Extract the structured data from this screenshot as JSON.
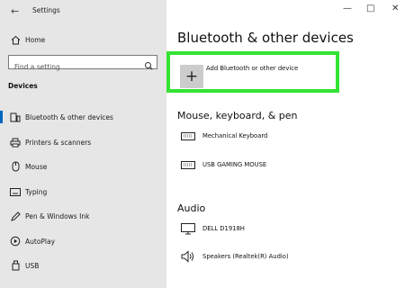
{
  "window": {
    "title": "Settings",
    "controls": [
      "—",
      "□",
      "✕"
    ]
  },
  "sidebar": {
    "home_label": "Home",
    "search_placeholder": "Find a setting",
    "section_label": "Devices",
    "items": [
      {
        "label": "Bluetooth & other devices",
        "icon": "bluetooth-devices-icon",
        "selected": true
      },
      {
        "label": "Printers & scanners",
        "icon": "printer-icon",
        "selected": false
      },
      {
        "label": "Mouse",
        "icon": "mouse-icon",
        "selected": false
      },
      {
        "label": "Typing",
        "icon": "keyboard-icon",
        "selected": false
      },
      {
        "label": "Pen & Windows Ink",
        "icon": "pen-icon",
        "selected": false
      },
      {
        "label": "AutoPlay",
        "icon": "autoplay-icon",
        "selected": false
      },
      {
        "label": "USB",
        "icon": "usb-icon",
        "selected": false
      }
    ]
  },
  "main": {
    "title": "Bluetooth & other devices",
    "add_device_label": "Add Bluetooth or other device",
    "groups": [
      {
        "heading": "Mouse, keyboard, & pen",
        "devices": [
          {
            "name": "Mechanical Keyboard",
            "icon": "keyboard-icon"
          },
          {
            "name": "USB GAMING MOUSE",
            "icon": "keyboard-icon"
          }
        ]
      },
      {
        "heading": "Audio",
        "devices": [
          {
            "name": "DELL D1918H",
            "icon": "monitor-icon"
          },
          {
            "name": "Speakers (Realtek(R) Audio)",
            "icon": "speaker-icon"
          }
        ]
      }
    ]
  },
  "colors": {
    "sidebar_bg": "#e6e6e6",
    "highlight_outline": "#34e334",
    "selection_accent": "#0067c0"
  }
}
